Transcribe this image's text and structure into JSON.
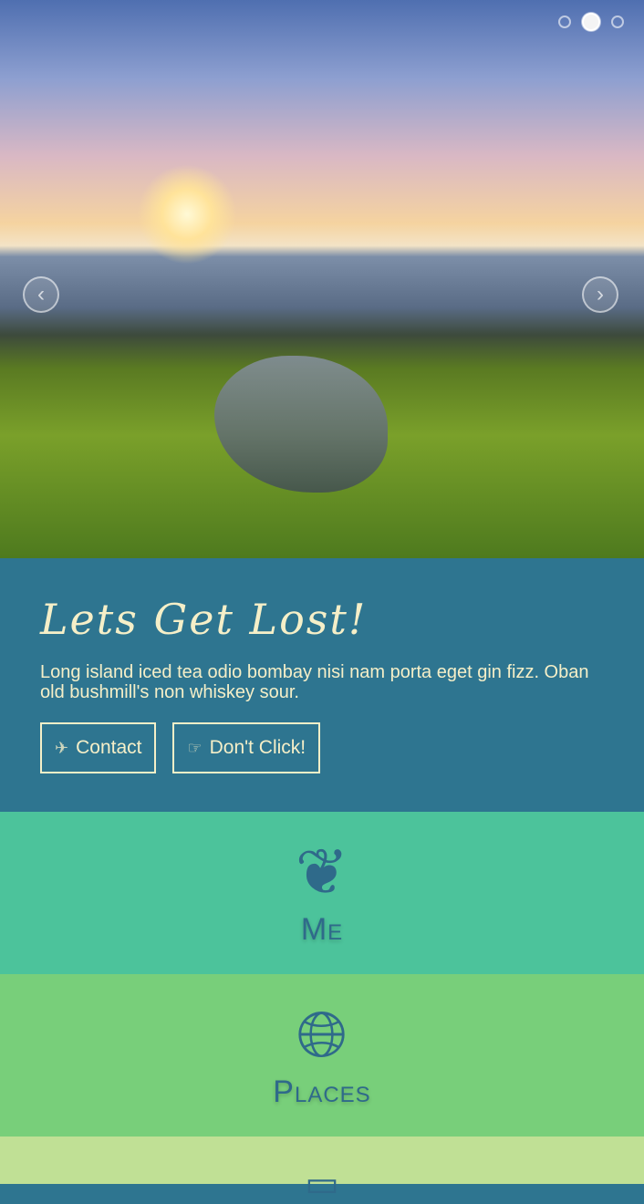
{
  "carousel": {
    "slides": 3,
    "active_index": 1,
    "prev_icon": "chevron-left-icon",
    "next_icon": "chevron-right-icon"
  },
  "intro": {
    "title": "Lets Get Lost!",
    "text": "Long island iced tea odio bombay nisi nam porta eget gin fizz. Oban old bushmill's non whiskey sour.",
    "buttons": [
      {
        "label": "Contact",
        "icon": "paper-plane-icon"
      },
      {
        "label": "Don't Click!",
        "icon": "pointing-hand-icon"
      }
    ]
  },
  "sections": [
    {
      "label": "Me",
      "icon": "brain-icon",
      "color": "#4cc39b"
    },
    {
      "label": "Places",
      "icon": "globe-icon",
      "color": "#78cf7a"
    },
    {
      "label": "",
      "icon": "cards-icon",
      "color": "#c0e095"
    }
  ]
}
